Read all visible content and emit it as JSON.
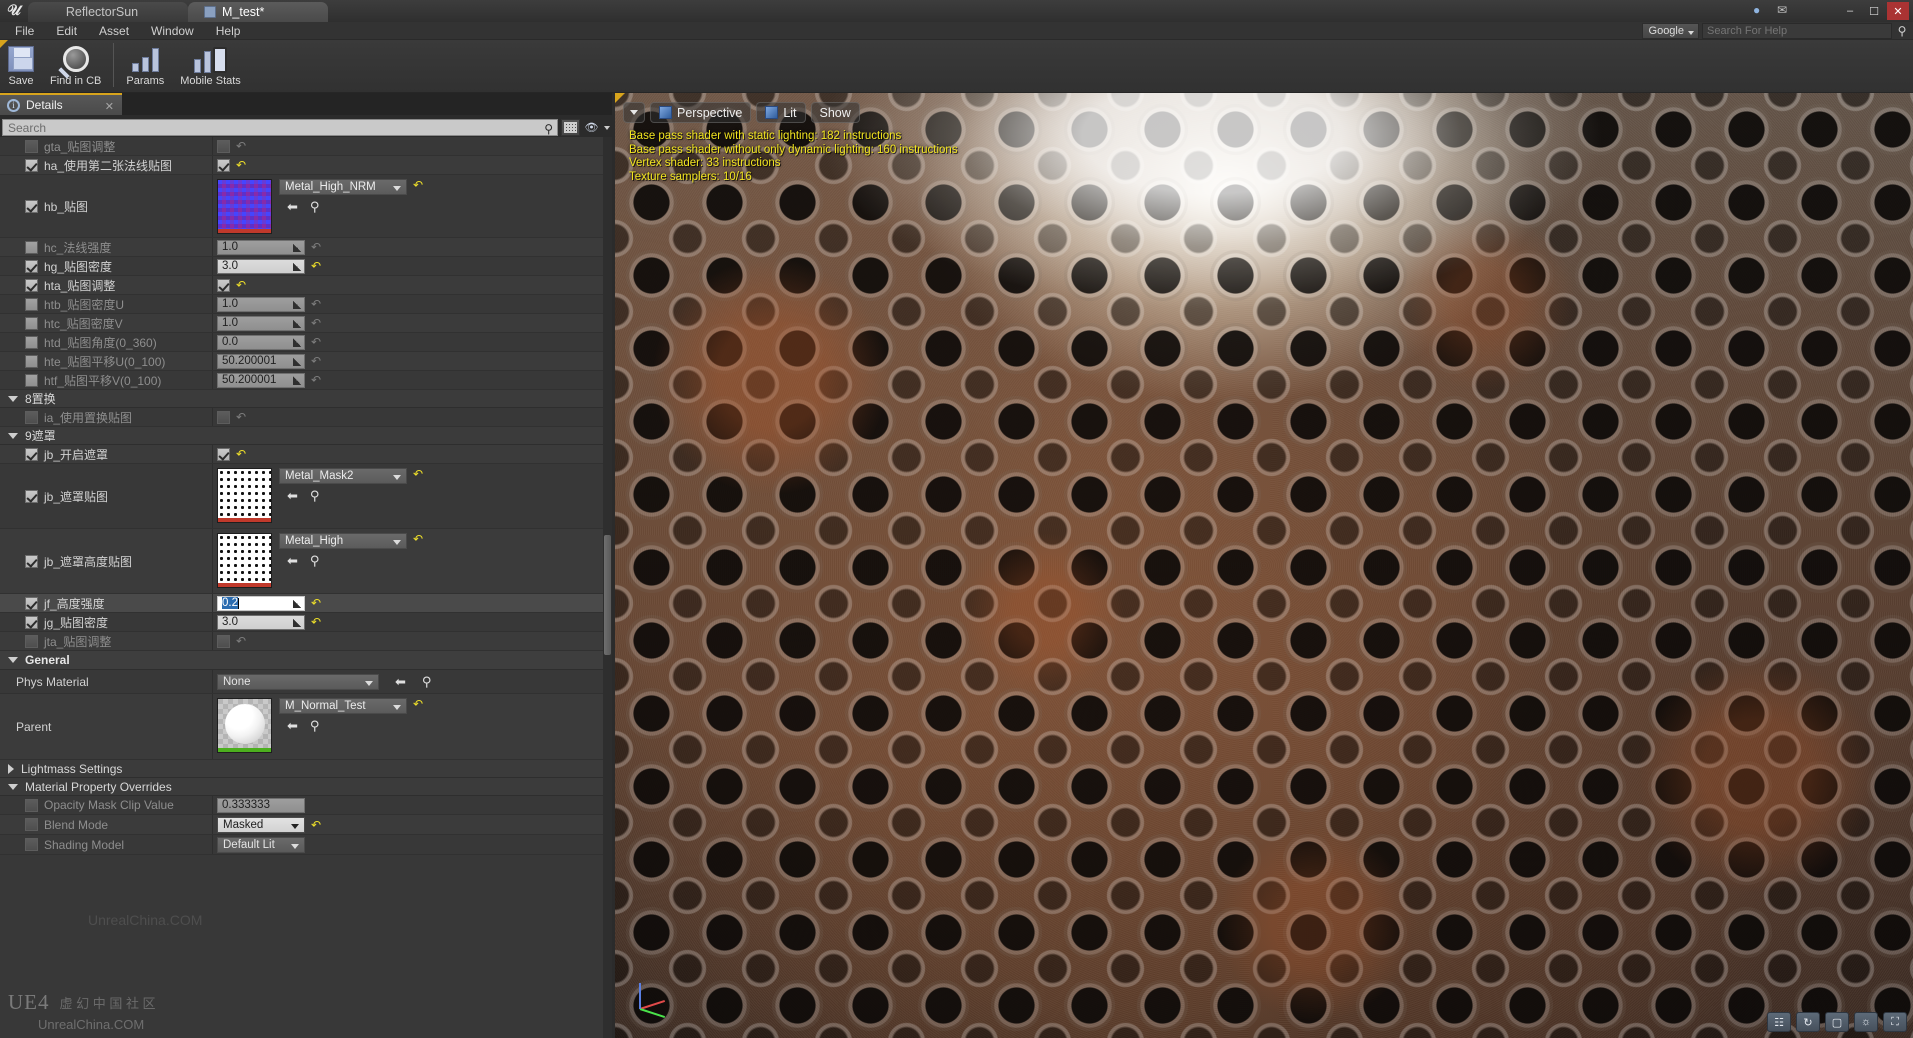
{
  "window": {
    "tabs": [
      {
        "label": "ReflectorSun",
        "active": false,
        "icon": "level-icon"
      },
      {
        "label": "M_test*",
        "active": true,
        "icon": "material-instance-icon"
      }
    ],
    "controls": {
      "minimize": "–",
      "maximize": "☐",
      "close": "✕"
    }
  },
  "menu": {
    "items": [
      "File",
      "Edit",
      "Asset",
      "Window",
      "Help"
    ],
    "search_provider": "Google",
    "help_placeholder": "Search For Help"
  },
  "toolbar": {
    "buttons": [
      {
        "label": "Save",
        "icon": "floppy-icon"
      },
      {
        "label": "Find in CB",
        "icon": "magnifier-icon"
      },
      {
        "label": "Params",
        "icon": "params-bars-icon"
      },
      {
        "label": "Mobile Stats",
        "icon": "mobile-stats-icon"
      }
    ]
  },
  "details": {
    "tab_label": "Details",
    "tab_icon": "info-icon",
    "close_icon": "close-icon",
    "search_placeholder": "Search",
    "search_value": "",
    "view_buttons": [
      "grid-view-icon",
      "eye-icon"
    ]
  },
  "properties": [
    {
      "type": "prop",
      "label": "gta_贴图调整",
      "enabled": false,
      "dim": true,
      "value_kind": "checkbox",
      "checked": false,
      "revert": false
    },
    {
      "type": "prop",
      "label": "ha_使用第二张法线贴图",
      "enabled": true,
      "dim": false,
      "value_kind": "checkbox",
      "checked": true,
      "revert": true
    },
    {
      "type": "asset",
      "label": "hb_贴图",
      "enabled": true,
      "dim": false,
      "asset_name": "Metal_High_NRM",
      "thumb": "normal-map-thumb",
      "revert": true
    },
    {
      "type": "prop",
      "label": "hc_法线强度",
      "enabled": false,
      "dim": true,
      "value_kind": "number",
      "value": "1.0",
      "bright": false,
      "revert": false
    },
    {
      "type": "prop",
      "label": "hg_贴图密度",
      "enabled": true,
      "dim": false,
      "value_kind": "number",
      "value": "3.0",
      "bright": true,
      "revert": true
    },
    {
      "type": "prop",
      "label": "hta_贴图调整",
      "enabled": true,
      "dim": false,
      "value_kind": "checkbox",
      "checked": true,
      "revert": true
    },
    {
      "type": "prop",
      "label": "htb_贴图密度U",
      "enabled": false,
      "dim": true,
      "value_kind": "number",
      "value": "1.0",
      "bright": false,
      "revert": false
    },
    {
      "type": "prop",
      "label": "htc_贴图密度V",
      "enabled": false,
      "dim": true,
      "value_kind": "number",
      "value": "1.0",
      "bright": false,
      "revert": false
    },
    {
      "type": "prop",
      "label": "htd_贴图角度(0_360)",
      "enabled": false,
      "dim": true,
      "value_kind": "number",
      "value": "0.0",
      "bright": false,
      "revert": false
    },
    {
      "type": "prop",
      "label": "hte_贴图平移U(0_100)",
      "enabled": false,
      "dim": true,
      "value_kind": "number",
      "value": "50.200001",
      "bright": false,
      "revert": false
    },
    {
      "type": "prop",
      "label": "htf_贴图平移V(0_100)",
      "enabled": false,
      "dim": true,
      "value_kind": "number",
      "value": "50.200001",
      "bright": false,
      "revert": false
    },
    {
      "type": "category",
      "label": "8置换",
      "expanded": true
    },
    {
      "type": "prop",
      "label": "ia_使用置换贴图",
      "enabled": false,
      "dim": true,
      "value_kind": "checkbox",
      "checked": false,
      "revert": false
    },
    {
      "type": "category",
      "label": "9遮罩",
      "expanded": true
    },
    {
      "type": "prop",
      "label": "jb_开启遮罩",
      "enabled": true,
      "dim": false,
      "value_kind": "checkbox",
      "checked": true,
      "revert": true
    },
    {
      "type": "asset",
      "label": "jb_遮罩贴图",
      "enabled": true,
      "dim": false,
      "asset_name": "Metal_Mask2",
      "thumb": "mask-thumb",
      "revert": true
    },
    {
      "type": "asset",
      "label": "jb_遮罩高度贴图",
      "enabled": true,
      "dim": false,
      "asset_name": "Metal_High",
      "thumb": "mask-thumb",
      "revert": true
    },
    {
      "type": "prop",
      "label": "jf_高度强度",
      "enabled": true,
      "dim": false,
      "value_kind": "number-editing",
      "value": "0.2",
      "selected_row": true,
      "revert": true
    },
    {
      "type": "prop",
      "label": "jg_贴图密度",
      "enabled": true,
      "dim": false,
      "value_kind": "number",
      "value": "3.0",
      "bright": true,
      "revert": true
    },
    {
      "type": "prop",
      "label": "jta_贴图调整",
      "enabled": false,
      "dim": true,
      "value_kind": "checkbox",
      "checked": false,
      "revert": false
    }
  ],
  "general": {
    "title": "General",
    "phys_material_label": "Phys Material",
    "phys_material_value": "None",
    "parent_label": "Parent",
    "parent_value": "M_Normal_Test",
    "parent_thumb": "sphere-material-thumb"
  },
  "lightmass": {
    "label": "Lightmass Settings",
    "expanded": false
  },
  "overrides": {
    "title": "Material Property Overrides",
    "rows": [
      {
        "label": "Opacity Mask Clip Value",
        "enabled": false,
        "kind": "number",
        "value": "0.333333",
        "revert": false
      },
      {
        "label": "Blend Mode",
        "enabled": false,
        "kind": "combo",
        "value": "Masked",
        "revert": true
      },
      {
        "label": "Shading Model",
        "enabled": false,
        "kind": "combo",
        "value": "Default Lit",
        "revert": false
      }
    ]
  },
  "viewport": {
    "buttons": [
      {
        "label": "",
        "icon": "viewport-options-caret-icon"
      },
      {
        "label": "Perspective",
        "icon": "perspective-icon"
      },
      {
        "label": "Lit",
        "icon": "lit-cube-icon"
      },
      {
        "label": "Show",
        "icon": ""
      }
    ],
    "stats": [
      "Base pass shader with static lighting: 182 instructions",
      "Base pass shader without only dynamic lighting: 160 instructions",
      "Vertex shader: 33 instructions",
      "Texture samplers: 10/16"
    ],
    "stats_color": "#f2e520",
    "bottom_buttons": [
      "grid-snap-icon",
      "rotation-snap-icon",
      "scale-snap-icon",
      "camera-speed-icon",
      "maximize-viewport-icon"
    ]
  },
  "watermark": {
    "logo": "UE4",
    "line1": "虚 幻 中 国 社 区",
    "line2": "UnrealChina.COM",
    "faded": "UnrealChina.COM"
  }
}
